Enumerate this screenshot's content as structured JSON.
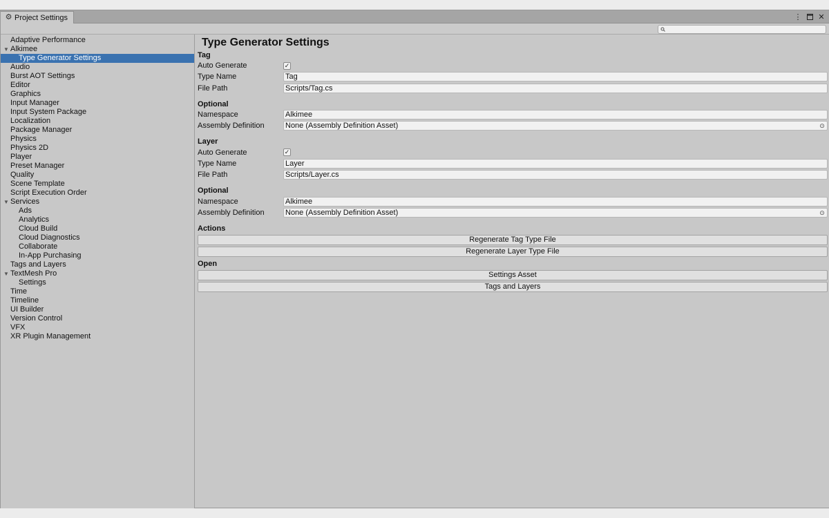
{
  "window": {
    "tab_title": "Project Settings",
    "tab_icon": "gear-icon",
    "controls": [
      "more-menu-icon",
      "maximize-icon",
      "close-icon"
    ]
  },
  "search": {
    "value": "",
    "placeholder": ""
  },
  "sidebar": {
    "items": [
      {
        "label": "Adaptive Performance",
        "level": 0
      },
      {
        "label": "Alkimee",
        "level": 0,
        "expanded": true
      },
      {
        "label": "Type Generator Settings",
        "level": 1,
        "selected": true
      },
      {
        "label": "Audio",
        "level": 0
      },
      {
        "label": "Burst AOT Settings",
        "level": 0
      },
      {
        "label": "Editor",
        "level": 0
      },
      {
        "label": "Graphics",
        "level": 0
      },
      {
        "label": "Input Manager",
        "level": 0
      },
      {
        "label": "Input System Package",
        "level": 0
      },
      {
        "label": "Localization",
        "level": 0
      },
      {
        "label": "Package Manager",
        "level": 0
      },
      {
        "label": "Physics",
        "level": 0
      },
      {
        "label": "Physics 2D",
        "level": 0
      },
      {
        "label": "Player",
        "level": 0
      },
      {
        "label": "Preset Manager",
        "level": 0
      },
      {
        "label": "Quality",
        "level": 0
      },
      {
        "label": "Scene Template",
        "level": 0
      },
      {
        "label": "Script Execution Order",
        "level": 0
      },
      {
        "label": "Services",
        "level": 0,
        "expanded": true
      },
      {
        "label": "Ads",
        "level": 1
      },
      {
        "label": "Analytics",
        "level": 1
      },
      {
        "label": "Cloud Build",
        "level": 1
      },
      {
        "label": "Cloud Diagnostics",
        "level": 1
      },
      {
        "label": "Collaborate",
        "level": 1
      },
      {
        "label": "In-App Purchasing",
        "level": 1
      },
      {
        "label": "Tags and Layers",
        "level": 0
      },
      {
        "label": "TextMesh Pro",
        "level": 0,
        "expanded": true
      },
      {
        "label": "Settings",
        "level": 1
      },
      {
        "label": "Time",
        "level": 0
      },
      {
        "label": "Timeline",
        "level": 0
      },
      {
        "label": "UI Builder",
        "level": 0
      },
      {
        "label": "Version Control",
        "level": 0
      },
      {
        "label": "VFX",
        "level": 0
      },
      {
        "label": "XR Plugin Management",
        "level": 0
      }
    ]
  },
  "main": {
    "title": "Type Generator Settings",
    "tag": {
      "title": "Tag",
      "auto_generate_label": "Auto Generate",
      "auto_generate": true,
      "type_name_label": "Type Name",
      "type_name": "Tag",
      "file_path_label": "File Path",
      "file_path": "Scripts/Tag.cs",
      "optional_title": "Optional",
      "namespace_label": "Namespace",
      "namespace": "Alkimee",
      "assembly_label": "Assembly Definition",
      "assembly": "None (Assembly Definition Asset)"
    },
    "layer": {
      "title": "Layer",
      "auto_generate_label": "Auto Generate",
      "auto_generate": true,
      "type_name_label": "Type Name",
      "type_name": "Layer",
      "file_path_label": "File Path",
      "file_path": "Scripts/Layer.cs",
      "optional_title": "Optional",
      "namespace_label": "Namespace",
      "namespace": "Alkimee",
      "assembly_label": "Assembly Definition",
      "assembly": "None (Assembly Definition Asset)"
    },
    "actions": {
      "title": "Actions",
      "regenerate_tag": "Regenerate Tag Type File",
      "regenerate_layer": "Regenerate Layer Type File"
    },
    "open": {
      "title": "Open",
      "settings_asset": "Settings Asset",
      "tags_and_layers": "Tags and Layers"
    }
  }
}
